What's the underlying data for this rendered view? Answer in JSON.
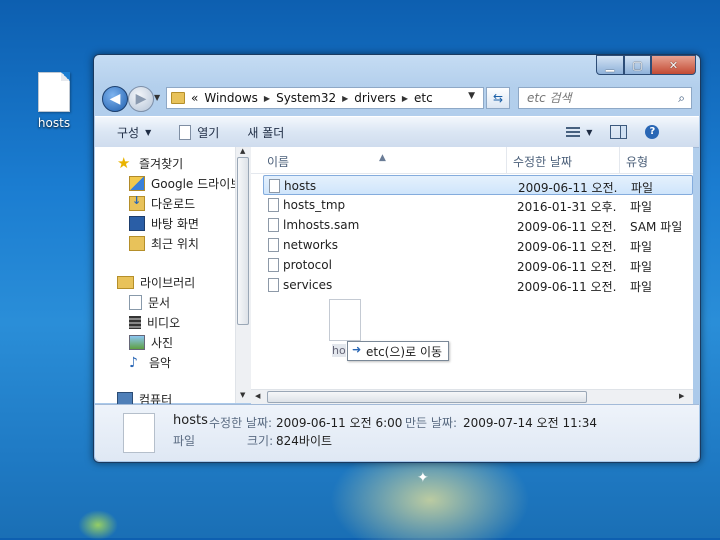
{
  "desktop": {
    "icon_label": "hosts"
  },
  "window": {
    "address": {
      "overflow": "«",
      "crumbs": [
        "Windows",
        "System32",
        "drivers",
        "etc"
      ]
    },
    "search_placeholder": "etc 검색",
    "toolbar": {
      "organize": "구성",
      "open": "열기",
      "new_folder": "새 폴더"
    },
    "nav": {
      "favorites": "즐겨찾기",
      "favorites_items": [
        "Google 드라이브",
        "다운로드",
        "바탕 화면",
        "최근 위치"
      ],
      "libraries": "라이브러리",
      "libraries_items": [
        "문서",
        "비디오",
        "사진",
        "음악"
      ],
      "computer": "컴퓨터"
    },
    "columns": {
      "name": "이름",
      "modified": "수정한 날짜",
      "type": "유형"
    },
    "files": [
      {
        "name": "hosts",
        "modified": "2009-06-11 오전...",
        "type": "파일"
      },
      {
        "name": "hosts_tmp",
        "modified": "2016-01-31 오후...",
        "type": "파일"
      },
      {
        "name": "lmhosts.sam",
        "modified": "2009-06-11 오전...",
        "type": "SAM 파일"
      },
      {
        "name": "networks",
        "modified": "2009-06-11 오전...",
        "type": "파일"
      },
      {
        "name": "protocol",
        "modified": "2009-06-11 오전...",
        "type": "파일"
      },
      {
        "name": "services",
        "modified": "2009-06-11 오전...",
        "type": "파일"
      }
    ],
    "drag": {
      "ghost_label": "ho",
      "tooltip": "etc(으)로 이동"
    },
    "details": {
      "name": "hosts",
      "modified_label": "수정한 날짜:",
      "modified_value": "2009-06-11 오전 6:00",
      "created_label": "만든 날짜:",
      "created_value": "2009-07-14 오전 11:34",
      "type": "파일",
      "size_label": "크기:",
      "size_value": "824바이트"
    }
  }
}
